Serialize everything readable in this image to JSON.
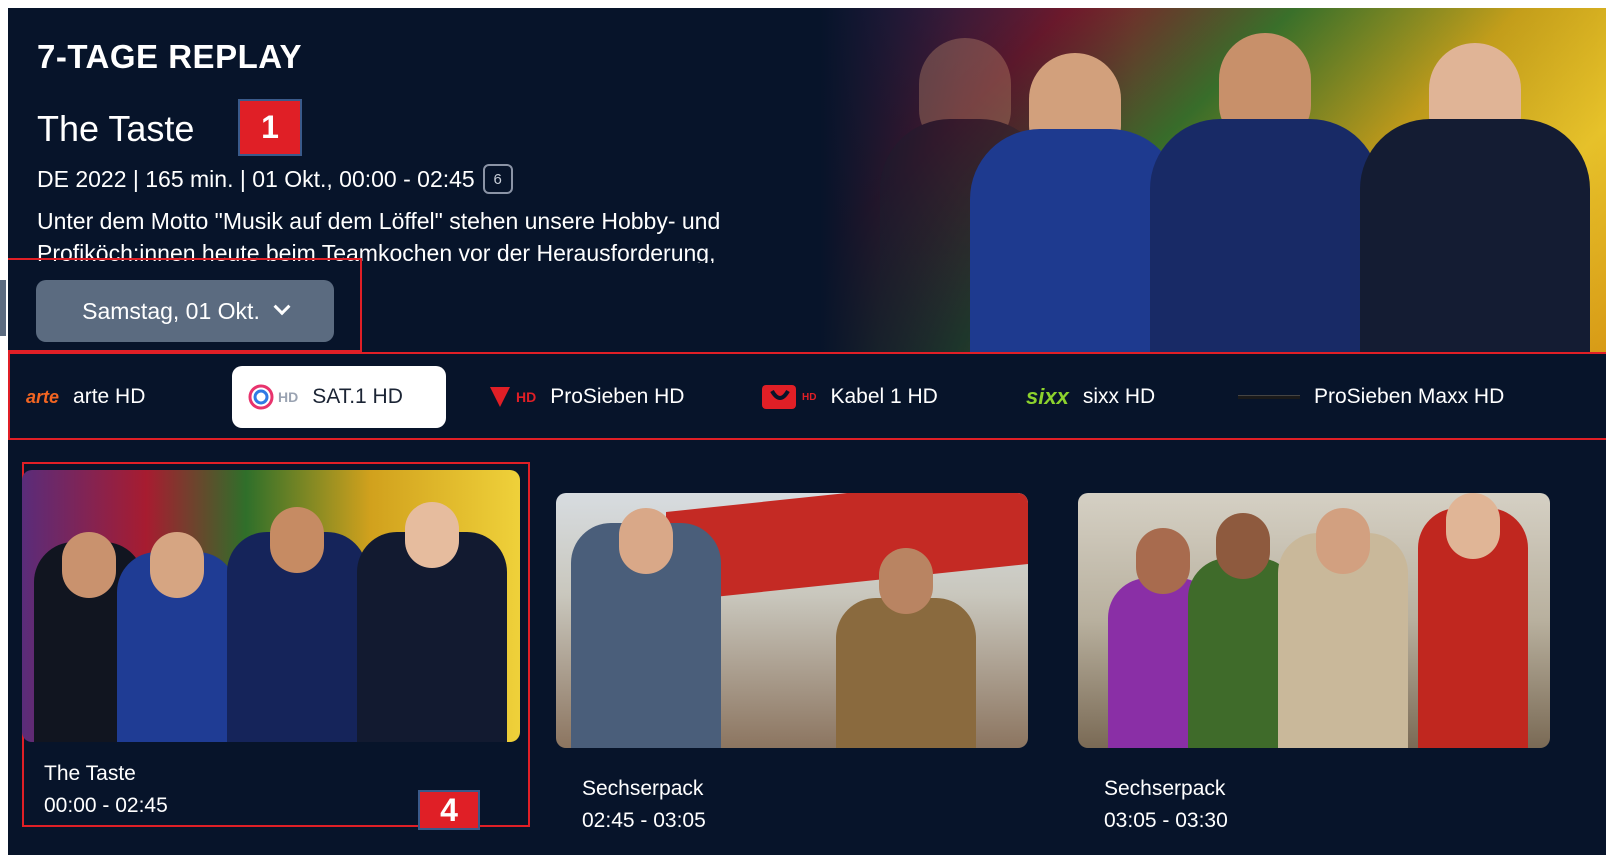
{
  "header": {
    "section_title": "7-TAGE REPLAY",
    "show_title": "The Taste",
    "meta": "DE 2022 | 165 min. | 01 Okt., 00:00 - 02:45",
    "age_rating": "6",
    "description": "Unter dem Motto \"Musik auf dem Löffel\" stehen unsere Hobby- und Profiköch:innen heute beim Teamkochen vor der Herausforderung,"
  },
  "date_selector": {
    "label": "Samstag, 01 Okt.",
    "icon": "chevron-down-icon"
  },
  "annotations": {
    "badge_1": "1",
    "badge_4": "4"
  },
  "channels": [
    {
      "logo": "arte",
      "label": "arte HD",
      "active": false
    },
    {
      "logo": "HD",
      "label": "SAT.1 HD",
      "active": true
    },
    {
      "logo": "HD",
      "label": "ProSieben HD",
      "active": false
    },
    {
      "logo": "HD",
      "label": "Kabel 1 HD",
      "active": false
    },
    {
      "logo": "sixx",
      "label": "sixx HD",
      "active": false
    },
    {
      "logo": "",
      "label": "ProSieben Maxx HD",
      "active": false
    }
  ],
  "programs": [
    {
      "title": "The Taste",
      "time": "00:00 - 02:45",
      "focused": true
    },
    {
      "title": "Sechserpack",
      "time": "02:45 - 03:05",
      "focused": false
    },
    {
      "title": "Sechserpack",
      "time": "03:05 - 03:30",
      "focused": false
    }
  ],
  "colors": {
    "background": "#07142a",
    "accent": "#e01f26",
    "button": "#5b6b80"
  }
}
